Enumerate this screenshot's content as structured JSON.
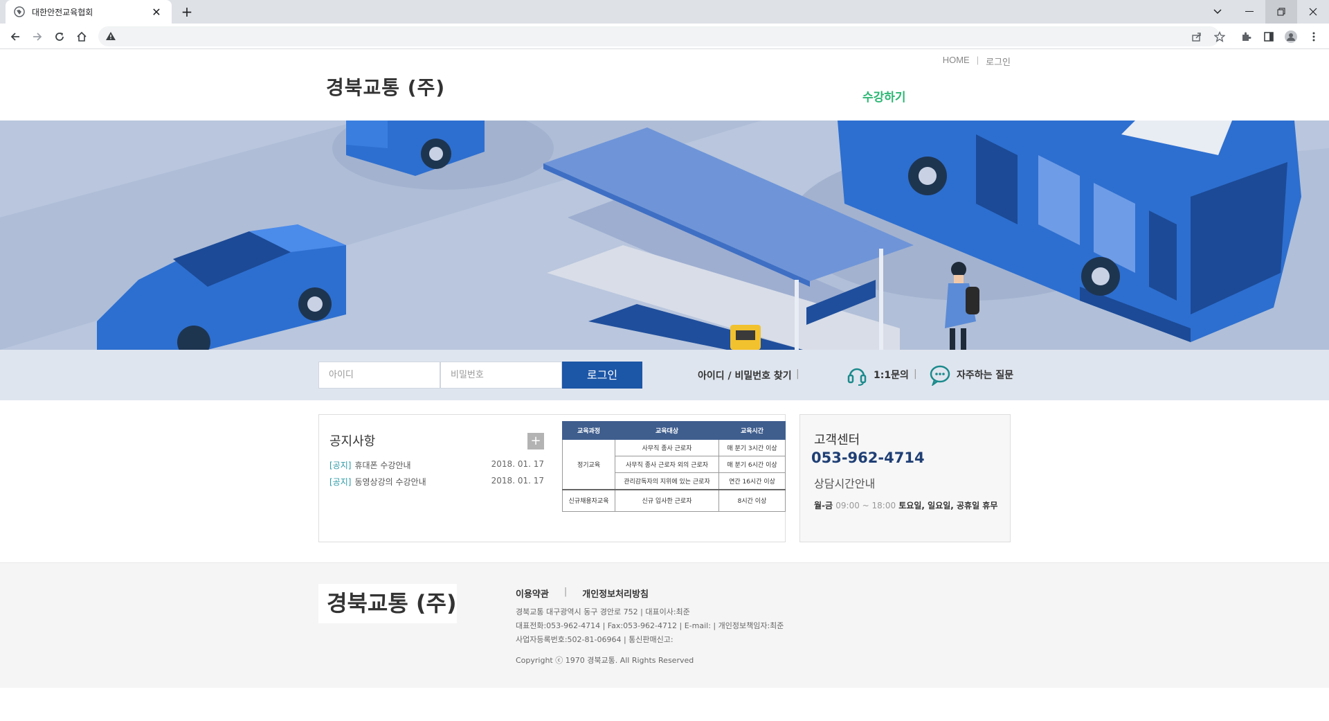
{
  "browser": {
    "tab_title": "대한안전교육협회",
    "close_glyph": "✕",
    "newtab_glyph": "+"
  },
  "header": {
    "util_nav": [
      "HOME",
      "로그인"
    ],
    "util_sep": "|",
    "logo": "경북교통 (주)",
    "menu_item": "수강하기"
  },
  "login": {
    "id_placeholder": "아이디",
    "pw_placeholder": "비밀번호",
    "button": "로그인",
    "find_link": "아이디 / 비밀번호 찾기",
    "sep": "|",
    "inquiry": "1:1문의",
    "faq": "자주하는 질문"
  },
  "notice": {
    "title": "공지사항",
    "more": "+",
    "items": [
      {
        "tag": "[공지]",
        "title": "휴대폰 수강안내",
        "date": "2018. 01. 17"
      },
      {
        "tag": "[공지]",
        "title": "동영상강의 수강안내",
        "date": "2018. 01. 17"
      }
    ]
  },
  "edu_table": {
    "headers": [
      "교육과정",
      "교육대상",
      "교육시간"
    ],
    "regular": {
      "course": "정기교육",
      "rows": [
        {
          "target": "사무직 종사 근로자",
          "time": "매 분기 3시간 이상"
        },
        {
          "target": "사무직 종사 근로자 외의 근로자",
          "time": "매 분기 6시간 이상"
        },
        {
          "target": "관리감독자의 지위에 있는 근로자",
          "time": "연간 16시간 이상"
        }
      ]
    },
    "new_hire": {
      "course": "신규채용자교육",
      "target": "신규 입사한 근로자",
      "time": "8시간 이상"
    }
  },
  "customer_center": {
    "title": "고객센터",
    "phone": "053-962-4714",
    "hours_title": "상담시간안내",
    "days": "월-금",
    "time": "09:00 ~ 18:00",
    "closed": "토요일, 일요일, 공휴일 휴무"
  },
  "footer": {
    "logo": "경북교통 (주)",
    "links": [
      "이용약관",
      "개인정보처리방침"
    ],
    "sep": "|",
    "lines": [
      "경북교통 대구광역시 동구 경안로 752 | 대표이사:최준",
      "대표전화:053-962-4714 | Fax:053-962-4712 | E-mail: | 개인정보책임자:최준",
      "사업자등록번호:502-81-06964 | 통신판매신고:"
    ],
    "copyright": "Copyright ⓒ 1970 경북교통. All Rights Reserved"
  },
  "colors": {
    "accent": "#2bb673",
    "login_button": "#1c56a7",
    "table_header": "#3f5e8e",
    "hero_bus": "#2d6fd0"
  }
}
